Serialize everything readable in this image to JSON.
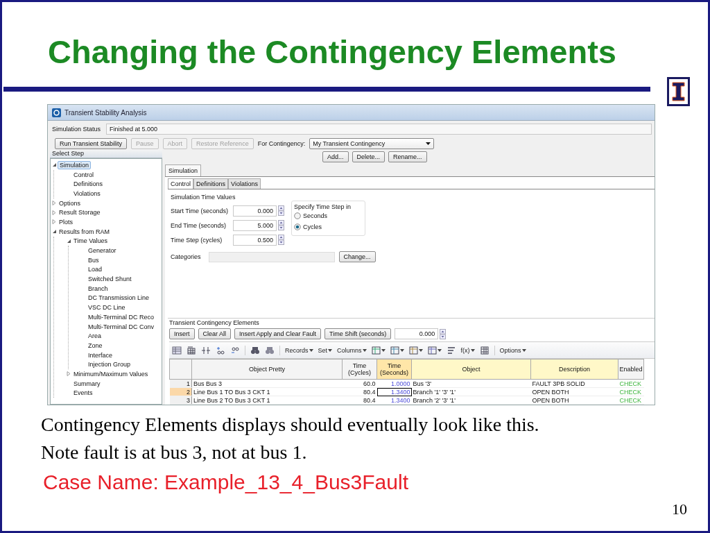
{
  "slide": {
    "title": "Changing the Contingency Elements",
    "caption_lines": [
      "Contingency Elements displays should eventually look like this.",
      "Note fault is at bus 3, not at bus 1."
    ],
    "case_name": "Case Name: Example_13_4_Bus3Fault",
    "page_number": "10"
  },
  "window": {
    "title": "Transient Stability Analysis",
    "status_label": "Simulation Status",
    "status_value": "Finished at 5.000"
  },
  "buttons": [
    {
      "label": "Run Transient Stability",
      "disabled": false
    },
    {
      "label": "Pause",
      "disabled": true
    },
    {
      "label": "Abort",
      "disabled": true
    },
    {
      "label": "Restore Reference",
      "disabled": true
    }
  ],
  "contingency": {
    "label": "For Contingency:",
    "value": "My Transient Contingency",
    "buttons": [
      "Add...",
      "Delete...",
      "Rename..."
    ]
  },
  "sidebar": {
    "title": "Select Step",
    "items": [
      {
        "label": "Simulation",
        "expanded": true,
        "selected": true,
        "children": [
          {
            "label": "Control",
            "selected": false
          },
          {
            "label": "Definitions",
            "selected": false
          },
          {
            "label": "Violations",
            "selected": false
          }
        ]
      },
      {
        "label": "Options",
        "expanded": false,
        "selected": false
      },
      {
        "label": "Result Storage",
        "expanded": false,
        "selected": false
      },
      {
        "label": "Plots",
        "expanded": false,
        "selected": false
      },
      {
        "label": "Results from RAM",
        "expanded": true,
        "selected": false,
        "children": [
          {
            "label": "Time Values",
            "expanded": true,
            "selected": false,
            "children": [
              {
                "label": "Generator",
                "selected": false
              },
              {
                "label": "Bus",
                "selected": false
              },
              {
                "label": "Load",
                "selected": false
              },
              {
                "label": "Switched Shunt",
                "selected": false
              },
              {
                "label": "Branch",
                "selected": false
              },
              {
                "label": "DC Transmission Line",
                "selected": false
              },
              {
                "label": "VSC DC Line",
                "selected": false
              },
              {
                "label": "Multi-Terminal DC Reco",
                "selected": false
              },
              {
                "label": "Multi-Terminal DC Conv",
                "selected": false
              },
              {
                "label": "Area",
                "selected": false
              },
              {
                "label": "Zone",
                "selected": false
              },
              {
                "label": "Interface",
                "selected": false
              },
              {
                "label": "Injection Group",
                "selected": false
              }
            ]
          },
          {
            "label": "Minimum/Maximum Values",
            "expanded": false,
            "selected": false
          },
          {
            "label": "Summary",
            "selected": false
          },
          {
            "label": "Events",
            "selected": false
          }
        ]
      }
    ]
  },
  "tabs": [
    {
      "label": "Simulation",
      "selected": true
    }
  ],
  "subtabs": [
    {
      "label": "Control",
      "selected": true
    },
    {
      "label": "Definitions",
      "selected": false
    },
    {
      "label": "Violations",
      "selected": false
    }
  ],
  "time_values": {
    "title": "Simulation Time Values",
    "fields": [
      {
        "label": "Start Time (seconds)",
        "value": "0.000"
      },
      {
        "label": "End Time (seconds)",
        "value": "5.000"
      },
      {
        "label": "Time Step (cycles)",
        "value": "0.500"
      }
    ]
  },
  "time_step_in": {
    "title": "Specify Time Step in",
    "options": [
      {
        "label": "Seconds",
        "selected": false
      },
      {
        "label": "Cycles",
        "selected": true
      }
    ]
  },
  "categories": {
    "label": "Categories",
    "button": "Change..."
  },
  "elements": {
    "title": "Transient Contingency Elements",
    "buttons": [
      "Insert",
      "Clear All",
      "Insert Apply and Clear Fault",
      "Time Shift (seconds)"
    ],
    "shift_value": "0.000",
    "toolbar": [
      {
        "kind": "icon"
      },
      {
        "kind": "icon"
      },
      {
        "kind": "icon"
      },
      {
        "kind": "icon"
      },
      {
        "kind": "icon"
      },
      {
        "kind": "separator"
      },
      {
        "kind": "icon"
      },
      {
        "kind": "icon"
      },
      {
        "kind": "separator"
      },
      {
        "kind": "menu",
        "label": "Records"
      },
      {
        "kind": "menu",
        "label": "Set"
      },
      {
        "kind": "menu",
        "label": "Columns"
      },
      {
        "kind": "iconmenu"
      },
      {
        "kind": "iconmenu"
      },
      {
        "kind": "iconmenu"
      },
      {
        "kind": "iconmenu"
      },
      {
        "kind": "icon"
      },
      {
        "kind": "menu",
        "label": "f(x)"
      },
      {
        "kind": "icon"
      },
      {
        "kind": "separator"
      },
      {
        "kind": "menu",
        "label": "Options"
      }
    ]
  },
  "table": {
    "columns": [
      {
        "label": "Object Pretty",
        "kind": "text"
      },
      {
        "label": "Time (Cycles)",
        "kind": "number"
      },
      {
        "label": "Time (Seconds)",
        "kind": "sorted"
      },
      {
        "label": "Object",
        "kind": "key"
      },
      {
        "label": "Description",
        "kind": "key"
      },
      {
        "label": "Enabled",
        "kind": "status"
      }
    ],
    "rows": [
      {
        "number": "1",
        "selected": false,
        "cells": [
          "Bus Bus 3",
          "60.0",
          "1.0000",
          "Bus '3'",
          "FAULT 3PB SOLID",
          "CHECK"
        ]
      },
      {
        "number": "2",
        "selected": true,
        "cells": [
          "Line Bus 1  TO  Bus 3 CKT 1",
          "80.4",
          "1.3400",
          "Branch '1' '3' '1'",
          "OPEN BOTH",
          "CHECK"
        ]
      },
      {
        "number": "3",
        "selected": false,
        "cells": [
          "Line Bus 2  TO  Bus 3 CKT 1",
          "80.4",
          "1.3400",
          "Branch '2' '3' '1'",
          "OPEN BOTH",
          "CHECK"
        ]
      }
    ]
  }
}
